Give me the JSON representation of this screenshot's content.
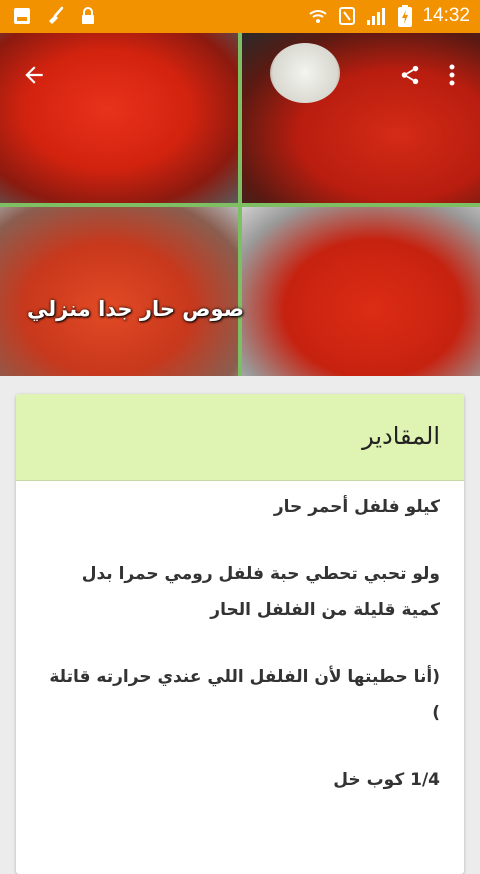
{
  "status_bar": {
    "time": "14:32",
    "left_icons": [
      "gallery-icon",
      "broom-icon",
      "lock-icon"
    ],
    "right_icons": [
      "wifi-icon",
      "nfc-icon",
      "signal-icon",
      "battery-charging-icon"
    ]
  },
  "toolbar": {
    "back_icon": "arrow-left-icon",
    "share_icon": "share-icon",
    "more_icon": "more-vertical-icon"
  },
  "recipe": {
    "title": "صوص حار جدا منزلي"
  },
  "ingredients": {
    "header": "المقادير",
    "lines": [
      "كيلو فلفل أحمر حار",
      "ولو تحبي تحطي حبة فلفل رومي حمرا بدل كمية قليلة من الفلفل الحار",
      "(أنا حطيتها لأن الفلفل اللي عندي حرارته قاتلة )",
      "1/4 كوب خل"
    ]
  },
  "colors": {
    "status_bar": "#f39200",
    "card_header": "#dff3b2",
    "page_background": "#ececec"
  }
}
